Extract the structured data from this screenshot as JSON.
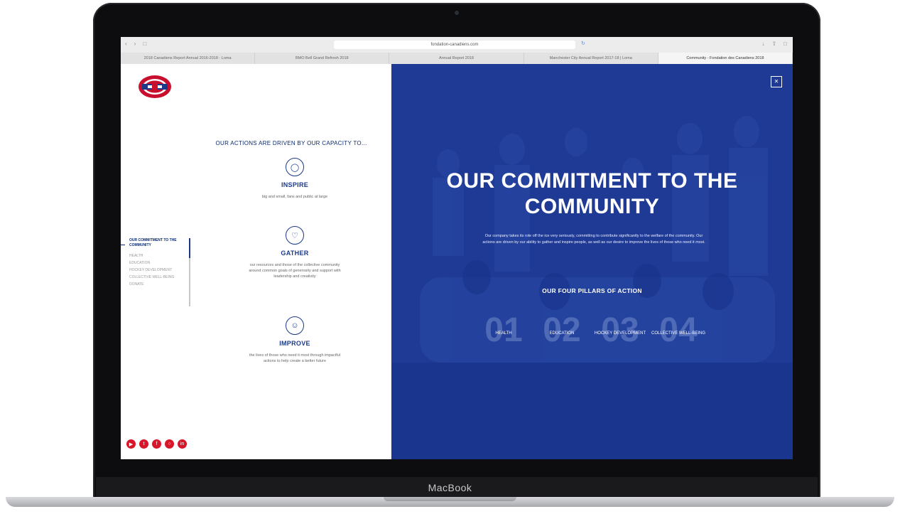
{
  "device": {
    "brand": "MacBook"
  },
  "browser": {
    "url": "fondation-canadiens.com",
    "tabs": [
      "2018 Canadiens Report Annual 2016-2018 - Loma",
      "BMO Bell Grand Refresh 2018",
      "Annual Report 2018",
      "Manchester City Annual Report 2017-18 | Loma",
      "Community - Fondation des Canadiens 2018"
    ]
  },
  "left": {
    "capacity_heading": "OUR ACTIONS ARE DRIVEN BY OUR CAPACITY TO...",
    "pillars": [
      {
        "title": "INSPIRE",
        "text": "big and small, fans and public at large"
      },
      {
        "title": "GATHER",
        "text": "our resources and those of the collective community around common goals of generosity and support with leadership and creativity"
      },
      {
        "title": "IMPROVE",
        "text": "the lives of those who need it most through impactful actions to help create a better future"
      }
    ],
    "side_nav": {
      "current": "OUR COMMITMENT TO THE COMMUNITY",
      "items": [
        "HEALTH",
        "EDUCATION",
        "HOCKEY DEVELOPMENT",
        "COLLECTIVE WELL-BEING",
        "DONATE"
      ]
    },
    "socials": [
      "youtube",
      "twitter",
      "facebook",
      "instagram",
      "linkedin"
    ]
  },
  "right": {
    "close_icon": "close-icon",
    "title": "OUR COMMITMENT TO THE COMMUNITY",
    "intro": "Our company takes its role off the ice very seriously, committing to contribute significantly to the welfare of the community. Our actions are driven by our ability to gather and inspire people, as well as our desire to improve the lives of those who need it most.",
    "pillars_label": "OUR FOUR PILLARS OF ACTION",
    "pillars": [
      {
        "num": "01",
        "label": "HEALTH"
      },
      {
        "num": "02",
        "label": "EDUCATION"
      },
      {
        "num": "03",
        "label": "HOCKEY DEVELOPMENT"
      },
      {
        "num": "04",
        "label": "COLLECTIVE WELL-BEING"
      }
    ]
  }
}
